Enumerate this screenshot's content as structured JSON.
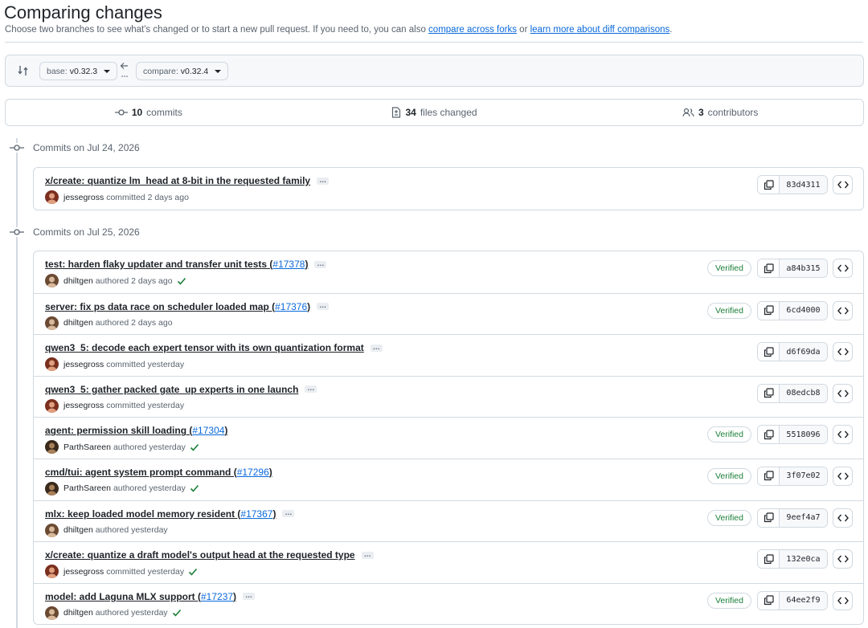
{
  "header": {
    "title": "Comparing changes",
    "subtitle_prefix": "Choose two branches to see what's changed or to start a new pull request. If you need to, you can also ",
    "link_forks": "compare across forks",
    "subtitle_mid": " or ",
    "link_learn": "learn more about diff comparisons",
    "subtitle_suffix": "."
  },
  "range": {
    "base_label": "base:",
    "base_value": "v0.32.3",
    "compare_label": "compare:",
    "compare_value": "v0.32.4"
  },
  "summary": {
    "commits_count": "10",
    "commits_label": "commits",
    "files_count": "34",
    "files_label": "files changed",
    "contributors_count": "3",
    "contributors_label": "contributors"
  },
  "groups": [
    {
      "date_label": "Commits on Jul 24, 2026",
      "commits": [
        {
          "message": "x/create: quantize lm_head at 8-bit in the requested family",
          "pr": "",
          "author": "jessegross",
          "action": "committed",
          "time": "2 days ago",
          "checked": false,
          "verified": false,
          "sha": "83d4311",
          "avatar": "b"
        }
      ]
    },
    {
      "date_label": "Commits on Jul 25, 2026",
      "commits": [
        {
          "message": "test: harden flaky updater and transfer unit tests (",
          "pr": "#17378",
          "author": "dhiltgen",
          "action": "authored",
          "time": "2 days ago",
          "checked": true,
          "verified": true,
          "sha": "a84b315",
          "avatar": "a"
        },
        {
          "message": "server: fix ps data race on scheduler loaded map (",
          "pr": "#17376",
          "author": "dhiltgen",
          "action": "authored",
          "time": "2 days ago",
          "checked": false,
          "verified": true,
          "sha": "6cd4000",
          "avatar": "a"
        },
        {
          "message": "qwen3_5: decode each expert tensor with its own quantization format",
          "pr": "",
          "author": "jessegross",
          "action": "committed",
          "time": "yesterday",
          "checked": false,
          "verified": false,
          "sha": "d6f69da",
          "avatar": "b"
        },
        {
          "message": "qwen3_5: gather packed gate_up experts in one launch",
          "pr": "",
          "author": "jessegross",
          "action": "committed",
          "time": "yesterday",
          "checked": false,
          "verified": false,
          "sha": "08edcb8",
          "avatar": "b"
        },
        {
          "message": "agent: permission skill loading (",
          "pr": "#17304",
          "author": "ParthSareen",
          "action": "authored",
          "time": "yesterday",
          "checked": true,
          "verified": true,
          "sha": "5518096",
          "avatar": "c",
          "no_ellipsis": true
        },
        {
          "message": "cmd/tui: agent system prompt command (",
          "pr": "#17296",
          "author": "ParthSareen",
          "action": "authored",
          "time": "yesterday",
          "checked": true,
          "verified": true,
          "sha": "3f07e02",
          "avatar": "c",
          "no_ellipsis": true
        },
        {
          "message": "mlx: keep loaded model memory resident (",
          "pr": "#17367",
          "author": "dhiltgen",
          "action": "authored",
          "time": "yesterday",
          "checked": false,
          "verified": true,
          "sha": "9eef4a7",
          "avatar": "a"
        },
        {
          "message": "x/create: quantize a draft model's output head at the requested type",
          "pr": "",
          "author": "jessegross",
          "action": "committed",
          "time": "yesterday",
          "checked": true,
          "verified": false,
          "sha": "132e0ca",
          "avatar": "b"
        },
        {
          "message": "model: add Laguna MLX support (",
          "pr": "#17237",
          "author": "dhiltgen",
          "action": "authored",
          "time": "yesterday",
          "checked": true,
          "verified": true,
          "sha": "64ee2f9",
          "avatar": "a"
        }
      ]
    }
  ],
  "labels": {
    "verified": "Verified"
  },
  "colors": {
    "link": "#0969da",
    "verified": "#1a7f37",
    "border": "#d1d9e0",
    "muted": "#59636e"
  },
  "icons": {
    "compare": "git-compare-icon",
    "commit": "git-commit-icon",
    "file": "file-diff-icon",
    "people": "people-icon",
    "copy": "copy-icon",
    "browse": "code-icon",
    "check": "check-icon",
    "arrow": "arrow-left-icon"
  }
}
